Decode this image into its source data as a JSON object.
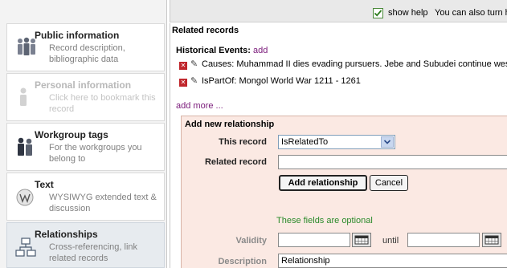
{
  "sidebar": {
    "items": [
      {
        "title": "Public information",
        "desc": "Record description, bibliographic data"
      },
      {
        "title": "Personal information",
        "desc": "Click here to bookmark this record"
      },
      {
        "title": "Workgroup tags",
        "desc": "For the workgroups you belong to"
      },
      {
        "title": "Text",
        "desc": "WYSIWYG extended text & discussion"
      },
      {
        "title": "Relationships",
        "desc": "Cross-referencing, link related records"
      }
    ]
  },
  "topbar": {
    "show_help": "show help",
    "show_help_checked": true,
    "help_info": "You can also turn h"
  },
  "main": {
    "heading": "Related records",
    "historical_label": "Historical Events:",
    "add_link": "add",
    "records": [
      {
        "text": "Causes: Muhammad II dies evading pursuers. Jebe and Subudei continue west"
      },
      {
        "text": "IsPartOf: Mongol World War 1211 - 1261"
      }
    ],
    "add_more": "add more ..."
  },
  "new_relationship": {
    "title": "Add new relationship",
    "this_record_label": "This record",
    "this_record_value": "IsRelatedTo",
    "related_record_label": "Related record",
    "related_record_value": "",
    "add_button": "Add relationship",
    "cancel_button": "Cancel",
    "optional_note": "These fields are optional",
    "validity_label": "Validity",
    "until_label": "until",
    "validity_from": "",
    "validity_until": "",
    "description_label": "Description",
    "description_value": "Relationship"
  }
}
